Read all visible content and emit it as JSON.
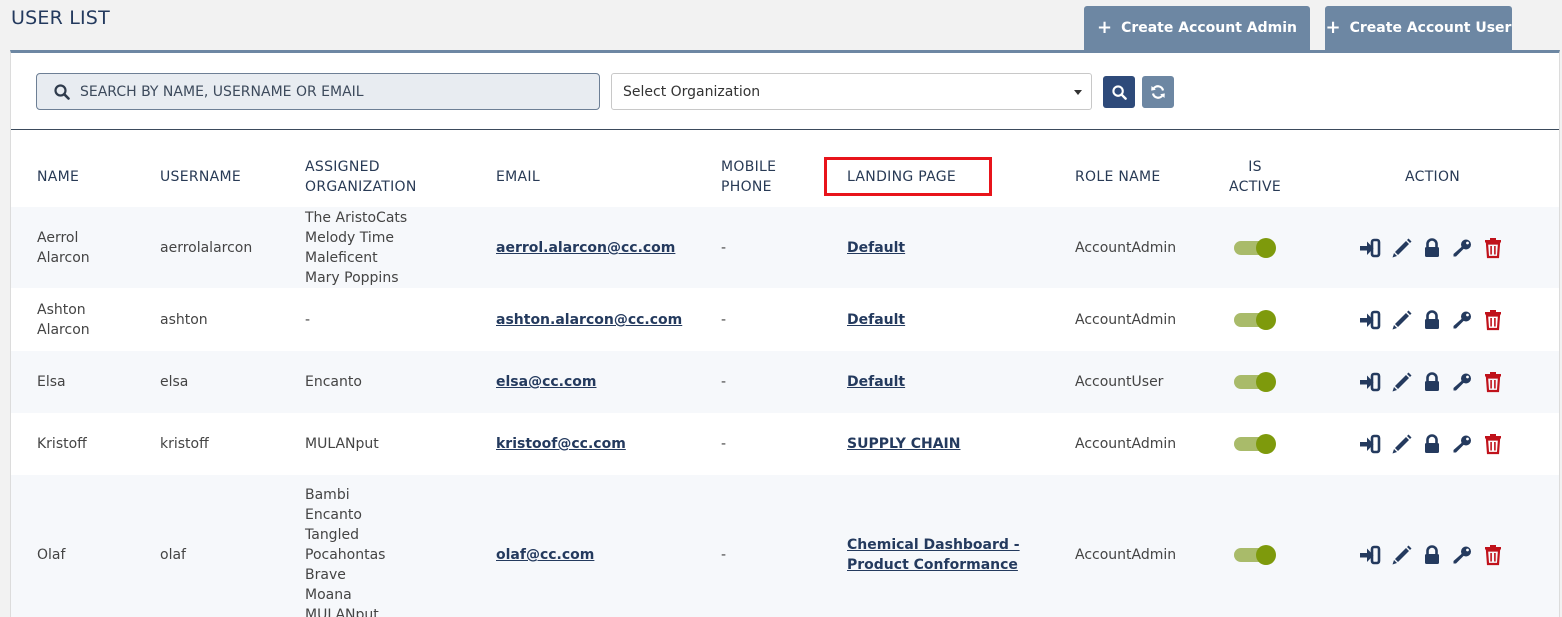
{
  "page": {
    "title": "USER LIST",
    "create_admin_label": "Create Account Admin",
    "create_user_label": "Create Account User"
  },
  "filters": {
    "search_placeholder": "SEARCH BY NAME, USERNAME OR EMAIL",
    "org_select_value": "Select Organization"
  },
  "table": {
    "headers": {
      "name": "NAME",
      "username": "USERNAME",
      "assigned_org_1": "ASSIGNED",
      "assigned_org_2": "ORGANIZATION",
      "email": "EMAIL",
      "mobile_1": "MOBILE",
      "mobile_2": "PHONE",
      "landing_page": "LANDING PAGE",
      "role_name": "ROLE NAME",
      "is_active_1": "IS",
      "is_active_2": "ACTIVE",
      "action": "ACTION"
    },
    "rows": [
      {
        "name": [
          "Aerrol",
          "Alarcon"
        ],
        "username": "aerrolalarcon",
        "orgs": [
          "The AristoCats",
          "Melody Time",
          "Maleficent",
          "Mary Poppins"
        ],
        "email": "aerrol.alarcon@cc.com",
        "mobile": "-",
        "landing": [
          "Default"
        ],
        "role": "AccountAdmin",
        "active": true
      },
      {
        "name": [
          "Ashton",
          "Alarcon"
        ],
        "username": "ashton",
        "orgs": [
          "-"
        ],
        "email": "ashton.alarcon@cc.com",
        "mobile": "-",
        "landing": [
          "Default"
        ],
        "role": "AccountAdmin",
        "active": true
      },
      {
        "name": [
          "Elsa"
        ],
        "username": "elsa",
        "orgs": [
          "Encanto"
        ],
        "email": "elsa@cc.com",
        "mobile": "-",
        "landing": [
          "Default"
        ],
        "role": "AccountUser",
        "active": true
      },
      {
        "name": [
          "Kristoff"
        ],
        "username": "kristoff",
        "orgs": [
          "MULANput"
        ],
        "email": "kristoof@cc.com",
        "mobile": "-",
        "landing": [
          "SUPPLY CHAIN"
        ],
        "role": "AccountAdmin",
        "active": true
      },
      {
        "name": [
          "Olaf"
        ],
        "username": "olaf",
        "orgs": [
          "Bambi",
          "Encanto",
          "Tangled",
          "Pocahontas",
          "Brave",
          "Moana",
          "MULANput"
        ],
        "email": "olaf@cc.com",
        "mobile": "-",
        "landing": [
          "Chemical Dashboard -",
          "Product Conformance"
        ],
        "role": "AccountAdmin",
        "active": true
      }
    ]
  },
  "colors": {
    "header_blue": "#6d87a3",
    "navy": "#243a5e",
    "toggle_on": "#7e9a0c",
    "delete_red": "#c0121b",
    "highlight_red": "#e8141b"
  },
  "icons": {
    "login": "login-icon",
    "edit": "pencil-icon",
    "lock": "lock-icon",
    "key": "key-icon",
    "delete": "trash-icon"
  }
}
